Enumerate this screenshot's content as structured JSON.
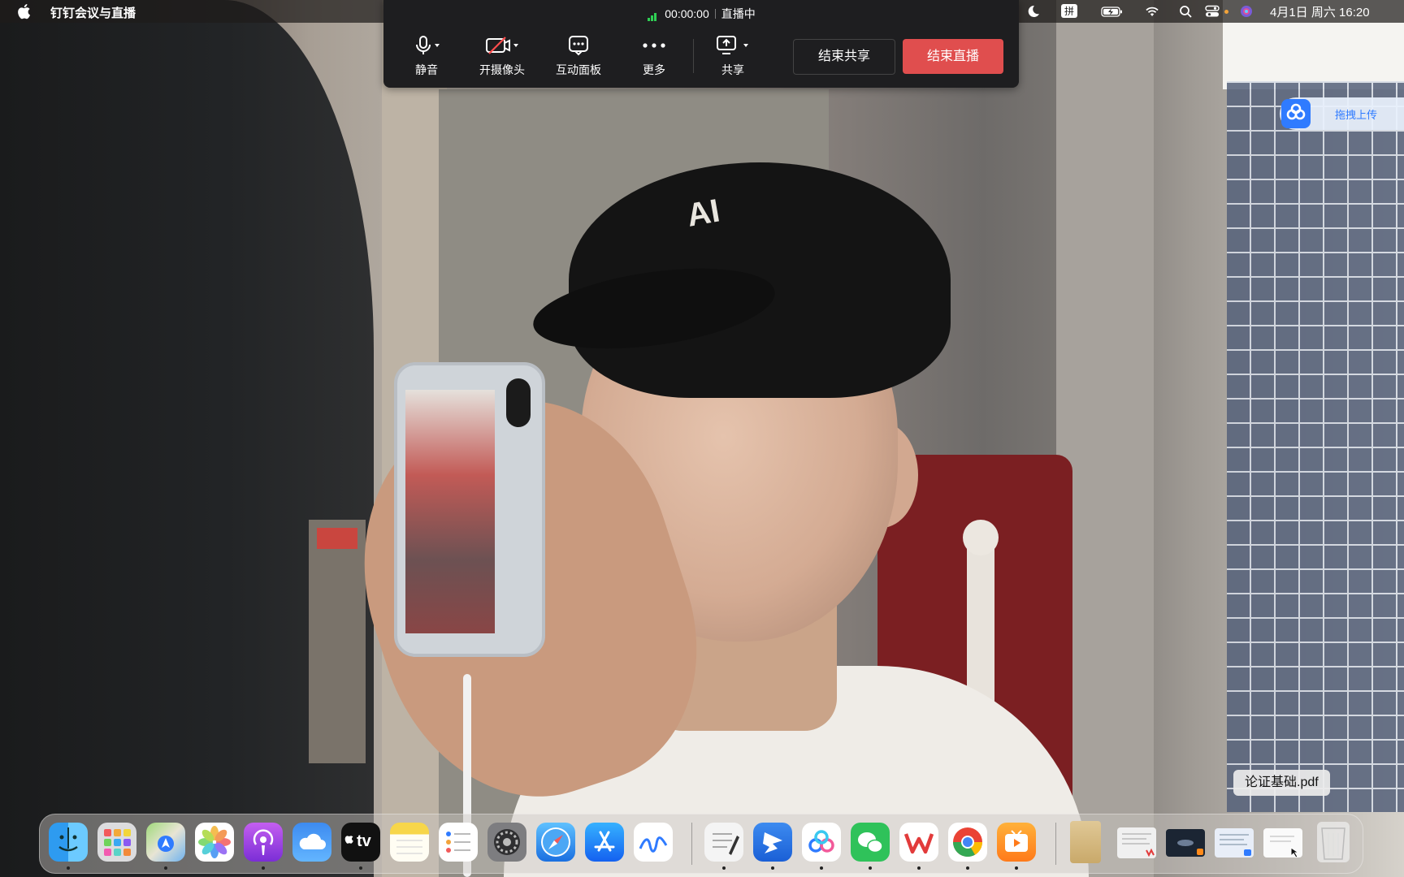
{
  "menubar": {
    "app_name": "钉钉会议与直播",
    "input_method": "拼",
    "datetime": "4月1日 周六 16:20"
  },
  "toolbar": {
    "timer": "00:00:00",
    "status": "直播中",
    "mute_label": "静音",
    "camera_label": "开摄像头",
    "interact_label": "互动面板",
    "more_label": "更多",
    "share_label": "共享",
    "end_share_label": "结束共享",
    "end_live_label": "结束直播"
  },
  "upload": {
    "label": "拖拽上传"
  },
  "tooltip": {
    "label": "论证基础.pdf"
  },
  "dock": {
    "apps": [
      {
        "name": "finder-icon"
      },
      {
        "name": "launchpad-icon"
      },
      {
        "name": "maps-icon"
      },
      {
        "name": "photos-icon"
      },
      {
        "name": "podcasts-icon"
      },
      {
        "name": "icloud-icon"
      },
      {
        "name": "apple-tv-icon"
      },
      {
        "name": "notes-icon"
      },
      {
        "name": "reminders-icon"
      },
      {
        "name": "system-settings-icon"
      },
      {
        "name": "safari-icon"
      },
      {
        "name": "app-store-icon"
      },
      {
        "name": "freeform-icon"
      },
      {
        "name": "textedit-icon"
      },
      {
        "name": "dingtalk-icon"
      },
      {
        "name": "baidu-netdisk-icon"
      },
      {
        "name": "wechat-icon"
      },
      {
        "name": "wps-icon"
      },
      {
        "name": "chrome-icon"
      },
      {
        "name": "video-app-icon"
      }
    ],
    "tv_label": "tv"
  },
  "colors": {
    "accent_red": "#e04e4e",
    "signal_green": "#2fcf54",
    "upload_blue": "#2f7bff"
  }
}
